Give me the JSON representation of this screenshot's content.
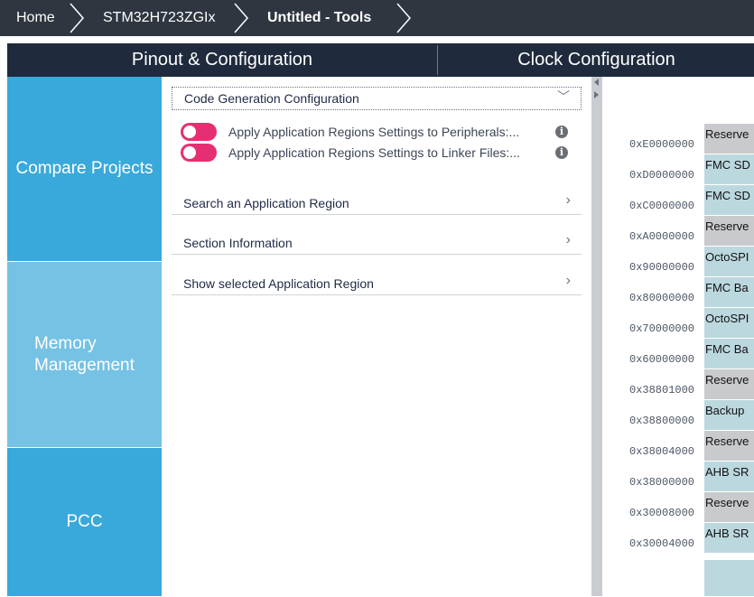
{
  "breadcrumb": [
    "Home",
    "STM32H723ZGIx",
    "Untitled - Tools"
  ],
  "tabs": {
    "pinout": "Pinout & Configuration",
    "clock": "Clock Configuration"
  },
  "nav": {
    "compare": "Compare Projects",
    "memory_line1": "Memory",
    "memory_line2": "Management",
    "pcc": "PCC"
  },
  "panel": {
    "code_gen": "Code Generation Configuration",
    "toggle1": "Apply Application Regions Settings to Peripherals:...",
    "toggle2": "Apply Application Regions Settings to Linker Files:...",
    "info": "i",
    "search": "Search an Application Region",
    "section": "Section Information",
    "show": "Show selected Application Region",
    "chevron_down": "﹀",
    "chevron_right": "›"
  },
  "memory_map": {
    "addresses": [
      "0xE0000000",
      "0xD0000000",
      "0xC0000000",
      "0xA0000000",
      "0x90000000",
      "0x80000000",
      "0x70000000",
      "0x60000000",
      "0x38801000",
      "0x38800000",
      "0x38004000",
      "0x38000000",
      "0x30008000",
      "0x30004000"
    ],
    "regions": [
      "Reserve",
      "FMC SD",
      "FMC SD",
      "Reserve",
      "OctoSPI",
      "FMC Ba",
      "OctoSPI",
      "FMC Ba",
      "Reserve",
      "Backup",
      "Reserve",
      "AHB SR",
      "Reserve",
      "AHB SR"
    ]
  },
  "colors": {
    "toggle": "#e62f72",
    "nav_active": "#39a9db",
    "nav_light": "#75c2e5",
    "tabbar": "#1f2b3d"
  }
}
